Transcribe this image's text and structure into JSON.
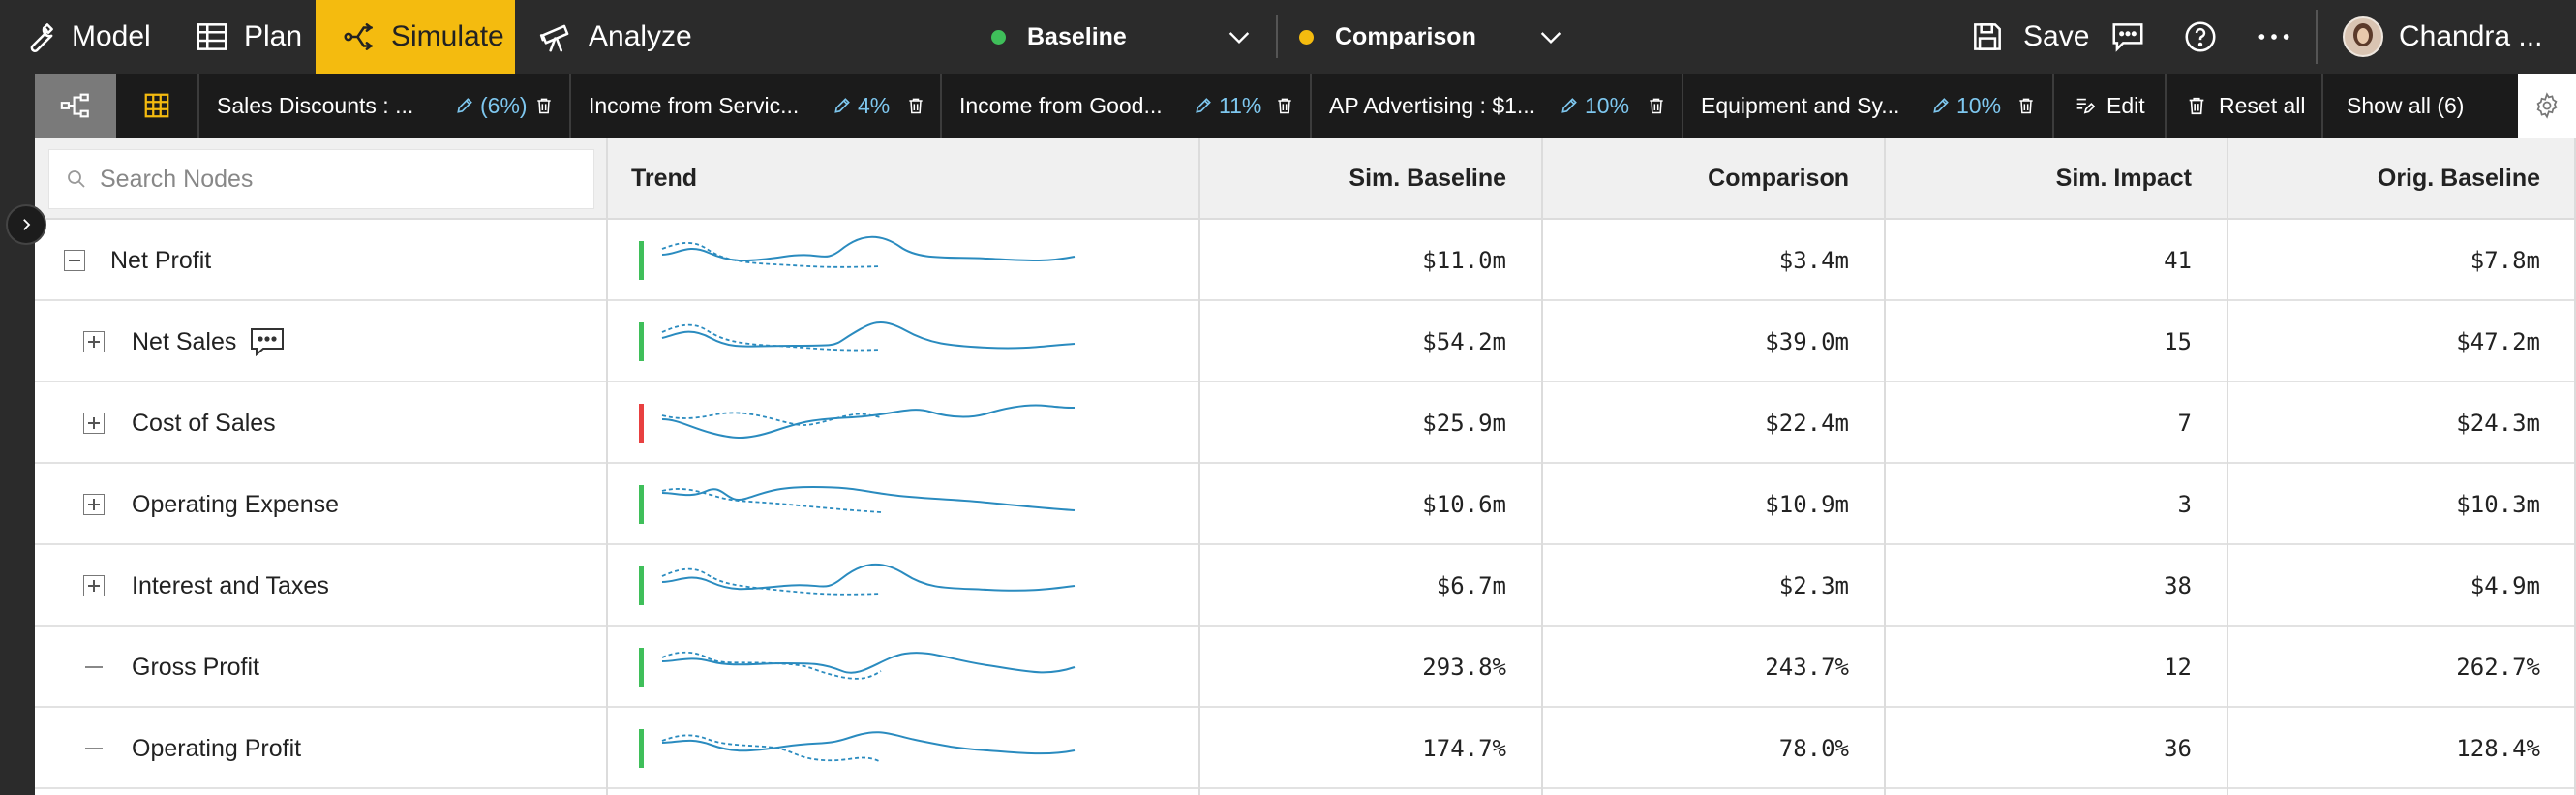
{
  "topbar": {
    "model_label": "Model",
    "plan_label": "Plan",
    "simulate_label": "Simulate",
    "analyze_label": "Analyze",
    "baseline_label": "Baseline",
    "baseline_color": "#3fbf5a",
    "comparison_label": "Comparison",
    "comparison_color": "#f4bb0f",
    "save_label": "Save",
    "user_name": "Chandra ..."
  },
  "filters": [
    {
      "name": "Sales Discounts : ...",
      "pct": "(6%)"
    },
    {
      "name": "Income from Servic...",
      "pct": "4%"
    },
    {
      "name": "Income from Good...",
      "pct": "11%"
    },
    {
      "name": "AP Advertising : $1...",
      "pct": "10%"
    },
    {
      "name": "Equipment and Sy...",
      "pct": "10%"
    }
  ],
  "filterbar": {
    "edit_label": "Edit",
    "reset_label": "Reset all",
    "show_all_label": "Show all (6)"
  },
  "table": {
    "search_placeholder": "Search Nodes",
    "headers": {
      "trend": "Trend",
      "sim_baseline": "Sim. Baseline",
      "comparison": "Comparison",
      "sim_impact": "Sim. Impact",
      "orig_baseline": "Orig. Baseline"
    },
    "rows": [
      {
        "name": "Net Profit",
        "status_color": "#3fbf5a",
        "sim_baseline": "$11.0m",
        "comparison": "$3.4m",
        "sim_impact": "41",
        "orig_baseline": "$7.8m"
      },
      {
        "name": "Net Sales",
        "status_color": "#3fbf5a",
        "sim_baseline": "$54.2m",
        "comparison": "$39.0m",
        "sim_impact": "15",
        "orig_baseline": "$47.2m"
      },
      {
        "name": "Cost of Sales",
        "status_color": "#e84040",
        "sim_baseline": "$25.9m",
        "comparison": "$22.4m",
        "sim_impact": "7",
        "orig_baseline": "$24.3m"
      },
      {
        "name": "Operating Expense",
        "status_color": "#3fbf5a",
        "sim_baseline": "$10.6m",
        "comparison": "$10.9m",
        "sim_impact": "3",
        "orig_baseline": "$10.3m"
      },
      {
        "name": "Interest and Taxes",
        "status_color": "#3fbf5a",
        "sim_baseline": "$6.7m",
        "comparison": "$2.3m",
        "sim_impact": "38",
        "orig_baseline": "$4.9m"
      },
      {
        "name": "Gross Profit",
        "status_color": "#3fbf5a",
        "sim_baseline": "293.8%",
        "comparison": "243.7%",
        "sim_impact": "12",
        "orig_baseline": "262.7%"
      },
      {
        "name": "Operating Profit",
        "status_color": "#3fbf5a",
        "sim_baseline": "174.7%",
        "comparison": "78.0%",
        "sim_impact": "36",
        "orig_baseline": "128.4%"
      }
    ]
  }
}
